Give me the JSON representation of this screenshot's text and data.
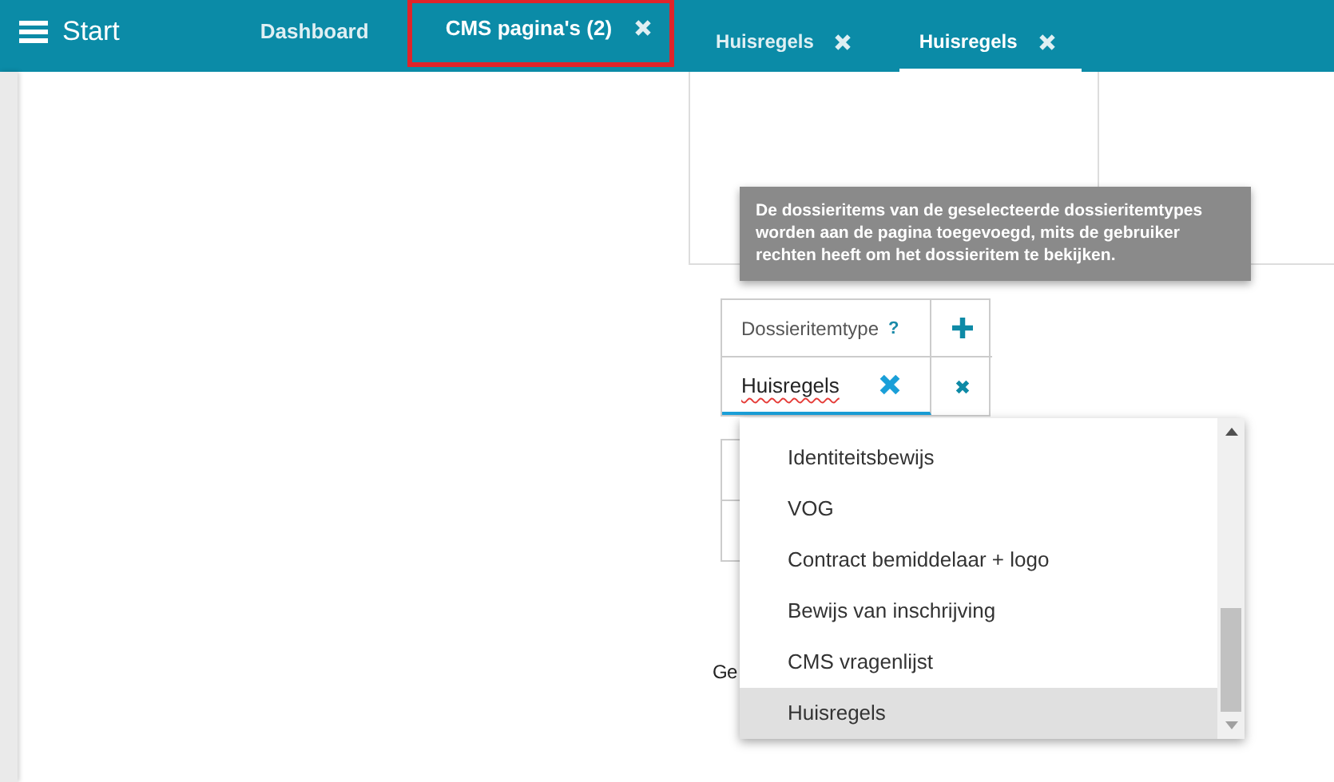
{
  "header": {
    "title": "Start"
  },
  "tabs": [
    {
      "label": "Dashboard",
      "selected": false,
      "closable": false,
      "highlighted": false
    },
    {
      "label": "CMS pagina's (2)",
      "selected": true,
      "closable": true,
      "highlighted": true
    }
  ],
  "sub_tabs": [
    {
      "label": "Huisregels",
      "selected": false
    },
    {
      "label": "Huisregels",
      "selected": true
    }
  ],
  "tooltip": "De dossieritems van de geselecteerde dossieritemtypes worden aan de pagina toegevoegd, mits de gebruiker rechten heeft om het dossieritem te bekijken.",
  "table": {
    "header": "Dossieritemtype",
    "help": "?",
    "value": "Huisregels"
  },
  "label_below": "Ge",
  "dropdown": [
    {
      "label": "Identiteitsbewijs",
      "selected": false
    },
    {
      "label": "VOG",
      "selected": false
    },
    {
      "label": "Contract bemiddelaar + logo",
      "selected": false
    },
    {
      "label": "Bewijs van inschrijving",
      "selected": false
    },
    {
      "label": "CMS vragenlijst",
      "selected": false
    },
    {
      "label": "Huisregels",
      "selected": true
    }
  ]
}
